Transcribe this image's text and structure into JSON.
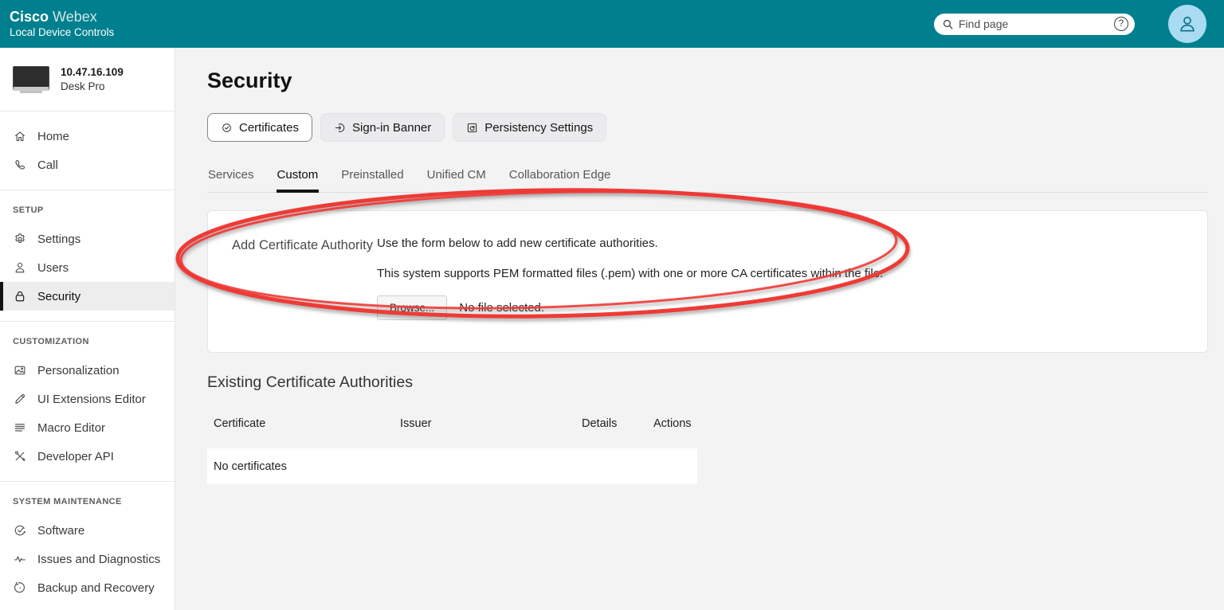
{
  "header": {
    "brand_primary": "Cisco",
    "brand_secondary": "Webex",
    "product": "Local Device Controls",
    "search_placeholder": "Find page",
    "help_glyph": "?",
    "colors": {
      "bar_bg": "#00808e",
      "avatar_bg": "#a9dbf2"
    }
  },
  "sidebar": {
    "device": {
      "ip": "10.47.16.109",
      "model": "Desk Pro"
    },
    "sections": [
      {
        "title": "",
        "items": [
          {
            "label": "Home",
            "icon": "home-icon",
            "selected": false
          },
          {
            "label": "Call",
            "icon": "call-icon",
            "selected": false
          }
        ]
      },
      {
        "title": "SETUP",
        "items": [
          {
            "label": "Settings",
            "icon": "gear-icon",
            "selected": false
          },
          {
            "label": "Users",
            "icon": "user-icon",
            "selected": false
          },
          {
            "label": "Security",
            "icon": "lock-icon",
            "selected": true
          }
        ]
      },
      {
        "title": "CUSTOMIZATION",
        "items": [
          {
            "label": "Personalization",
            "icon": "image-icon",
            "selected": false
          },
          {
            "label": "UI Extensions Editor",
            "icon": "pencil-icon",
            "selected": false
          },
          {
            "label": "Macro Editor",
            "icon": "lines-icon",
            "selected": false
          },
          {
            "label": "Developer API",
            "icon": "crossed-tools-icon",
            "selected": false
          }
        ]
      },
      {
        "title": "SYSTEM MAINTENANCE",
        "items": [
          {
            "label": "Software",
            "icon": "circle-check-icon",
            "selected": false
          },
          {
            "label": "Issues and Diagnostics",
            "icon": "pulse-icon",
            "selected": false
          },
          {
            "label": "Backup and Recovery",
            "icon": "restore-icon",
            "selected": false
          }
        ]
      }
    ]
  },
  "main": {
    "title": "Security",
    "section_buttons": [
      {
        "label": "Certificates",
        "icon": "certificate-seal-icon",
        "selected": true
      },
      {
        "label": "Sign-in Banner",
        "icon": "sign-in-icon",
        "selected": false
      },
      {
        "label": "Persistency Settings",
        "icon": "persistency-icon",
        "selected": false
      }
    ],
    "tabs": [
      {
        "label": "Services",
        "active": false
      },
      {
        "label": "Custom",
        "active": true
      },
      {
        "label": "Preinstalled",
        "active": false
      },
      {
        "label": "Unified CM",
        "active": false
      },
      {
        "label": "Collaboration Edge",
        "active": false
      }
    ],
    "card": {
      "heading": "Add Certificate Authority",
      "description1": "Use the form below to add new certificate authorities.",
      "description2": "This system supports PEM formatted files (.pem) with one or more CA certificates within the file.",
      "browse_label": "Browse...",
      "file_status": "No file selected."
    },
    "existing": {
      "title": "Existing Certificate Authorities",
      "columns": [
        "Certificate",
        "Issuer",
        "Details",
        "Actions"
      ],
      "empty_text": "No certificates"
    }
  },
  "annotation": {
    "type": "hand-drawn-ellipse",
    "color": "#ee3a36"
  }
}
